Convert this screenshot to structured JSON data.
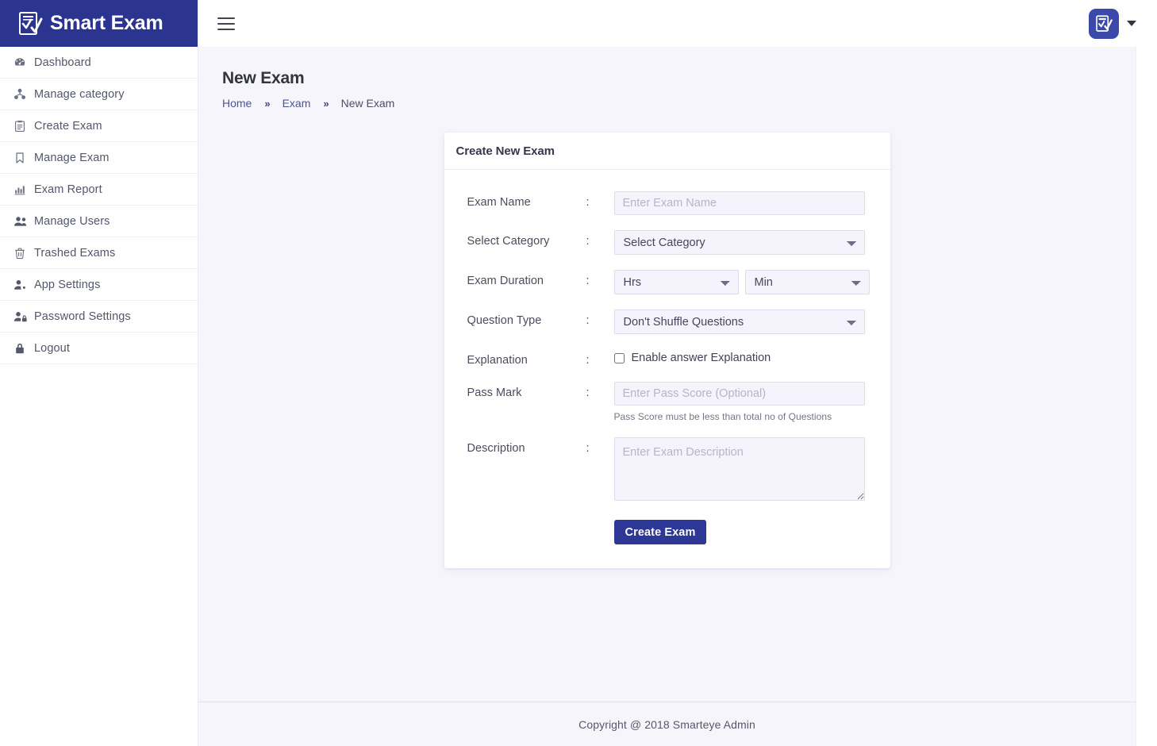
{
  "brand": {
    "title": "Smart Exam",
    "logo_icon": "exam-checklist-icon",
    "brand_color": "#2b3590"
  },
  "sidebar": {
    "items": [
      {
        "label": "Dashboard",
        "icon": "tachometer-icon"
      },
      {
        "label": "Manage category",
        "icon": "sitemap-icon"
      },
      {
        "label": "Create Exam",
        "icon": "clipboard-list-icon"
      },
      {
        "label": "Manage Exam",
        "icon": "bookmark-icon"
      },
      {
        "label": "Exam Report",
        "icon": "chart-bar-icon"
      },
      {
        "label": "Manage Users",
        "icon": "users-icon"
      },
      {
        "label": "Trashed Exams",
        "icon": "trash-icon"
      },
      {
        "label": "App Settings",
        "icon": "user-cog-icon"
      },
      {
        "label": "Password Settings",
        "icon": "user-lock-icon"
      },
      {
        "label": "Logout",
        "icon": "lock-icon"
      }
    ]
  },
  "topbar": {
    "menu_toggle_icon": "hamburger-icon",
    "avatar_icon": "exam-checklist-icon",
    "dropdown_icon": "caret-down-icon"
  },
  "page": {
    "title": "New Exam",
    "breadcrumb": [
      {
        "label": "Home",
        "type": "link"
      },
      {
        "label": "»",
        "type": "separator"
      },
      {
        "label": "Exam",
        "type": "link"
      },
      {
        "label": "»",
        "type": "separator"
      },
      {
        "label": "New Exam",
        "type": "current"
      }
    ]
  },
  "card": {
    "header_title": "Create New Exam",
    "colon": ":",
    "fields": {
      "exam_name": {
        "label": "Exam Name",
        "placeholder": "Enter Exam Name",
        "value": ""
      },
      "select_category": {
        "label": "Select Category",
        "selected": "Select Category"
      },
      "exam_duration": {
        "label": "Exam Duration",
        "hours_selected": "Hrs",
        "minutes_selected": "Min"
      },
      "question_type": {
        "label": "Question Type",
        "selected": "Don't Shuffle Questions"
      },
      "explanation": {
        "label": "Explanation",
        "checkbox_label": "Enable answer Explanation",
        "checked": false
      },
      "pass_mark": {
        "label": "Pass Mark",
        "placeholder": "Enter Pass Score (Optional)",
        "value": "",
        "hint": "Pass Score must be less than total no of Questions"
      },
      "description": {
        "label": "Description",
        "placeholder": "Enter Exam Description",
        "value": ""
      }
    },
    "submit_label": "Create Exam",
    "submit_color": "#2d3795"
  },
  "footer": {
    "text": "Copyright @ 2018 Smarteye Admin"
  }
}
